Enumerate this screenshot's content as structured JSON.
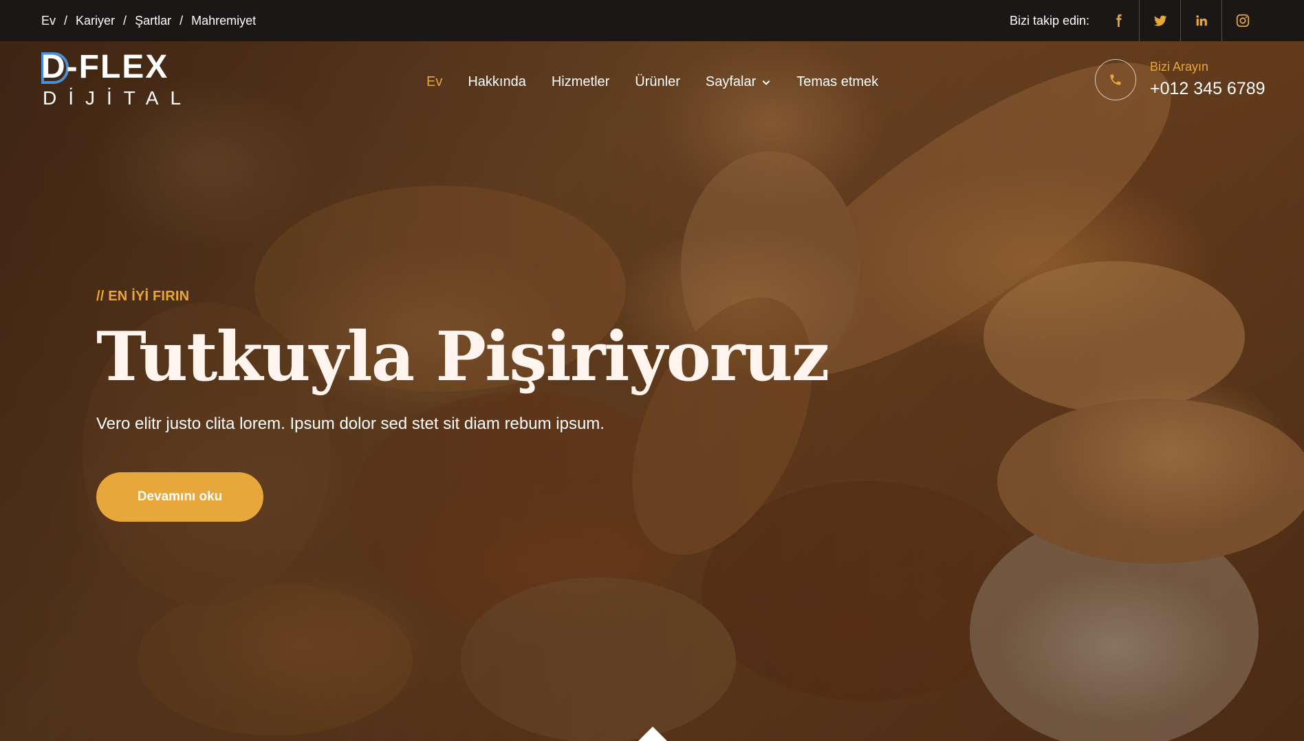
{
  "topbar": {
    "breadcrumb": [
      "Ev",
      "Kariyer",
      "Şartlar",
      "Mahremiyet"
    ],
    "separator": "/",
    "follow_label": "Bizi takip edin:",
    "social_icons": [
      "facebook-icon",
      "twitter-icon",
      "linkedin-icon",
      "instagram-icon"
    ]
  },
  "brand": {
    "logo_top": "D-FLEX",
    "logo_bottom": "DİJİTAL"
  },
  "nav": {
    "items": [
      {
        "label": "Ev",
        "active": true
      },
      {
        "label": "Hakkında",
        "active": false
      },
      {
        "label": "Hizmetler",
        "active": false
      },
      {
        "label": "Ürünler",
        "active": false
      },
      {
        "label": "Sayfalar",
        "active": false,
        "dropdown": true
      },
      {
        "label": "Temas etmek",
        "active": false
      }
    ],
    "call": {
      "label": "Bizi Arayın",
      "number": "+012 345 6789",
      "icon": "phone-icon"
    }
  },
  "hero": {
    "eyebrow": "// EN İYİ FIRIN",
    "headline": "Tutkuyla Pişiriyoruz",
    "subtitle": "Vero elitr justo clita lorem. Ipsum dolor sed stet sit diam rebum ipsum.",
    "cta_label": "Devamını oku"
  },
  "colors": {
    "accent": "#e8a73a",
    "topbar_bg": "#1b1716",
    "headline": "#fff5ee"
  }
}
